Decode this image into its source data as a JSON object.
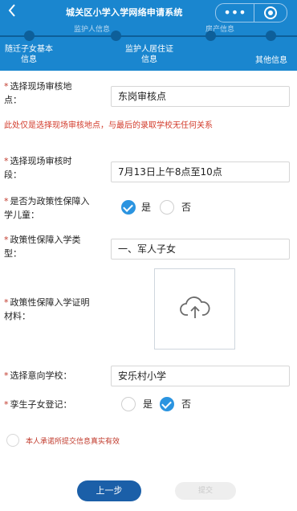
{
  "header": {
    "back_icon": "chevron-left-icon",
    "title": "城关区小学入学网络申请系统",
    "more_icon": "more-dots-icon",
    "close_icon": "close-circle-icon",
    "color": "#1a86cf"
  },
  "steps": {
    "faded_1": "监护人信息",
    "faded_2": "房产信息",
    "items": [
      {
        "label_1": "随迁子女基本",
        "label_2": "信息"
      },
      {
        "label_1": "监护人居住证",
        "label_2": "信息"
      },
      {
        "label_1": "其他信息"
      }
    ]
  },
  "form": {
    "required_mark": "*",
    "site": {
      "label_1": "选择现场审核地",
      "label_2": "点：",
      "value": "东岗审核点"
    },
    "note": "此处仅是选择现场审核地点，与最后的录取学校无任何关系",
    "time": {
      "label_1": "选择现场审核时",
      "label_2": "段：",
      "value": "7月13日上午8点至10点"
    },
    "policy": {
      "label_1": "是否为政策性保障入",
      "label_2": "学儿童：",
      "yes": "是",
      "no": "否",
      "selected": "是"
    },
    "policy_type": {
      "label_1": "政策性保障入学类",
      "label_2": "型：",
      "value": "一、军人子女"
    },
    "proof": {
      "label_1": "政策性保障入学证明",
      "label_2": "材料：",
      "upload_icon": "cloud-upload-icon"
    },
    "school": {
      "label": "选择意向学校：",
      "value": "安乐村小学"
    },
    "second_child": {
      "label": "孪生子女登记：",
      "yes": "是",
      "no": "否",
      "selected": "否"
    },
    "pledge": "本人承诺所提交信息真实有效"
  },
  "footer": {
    "prev_label": "上一步",
    "submit_label": "提交"
  }
}
